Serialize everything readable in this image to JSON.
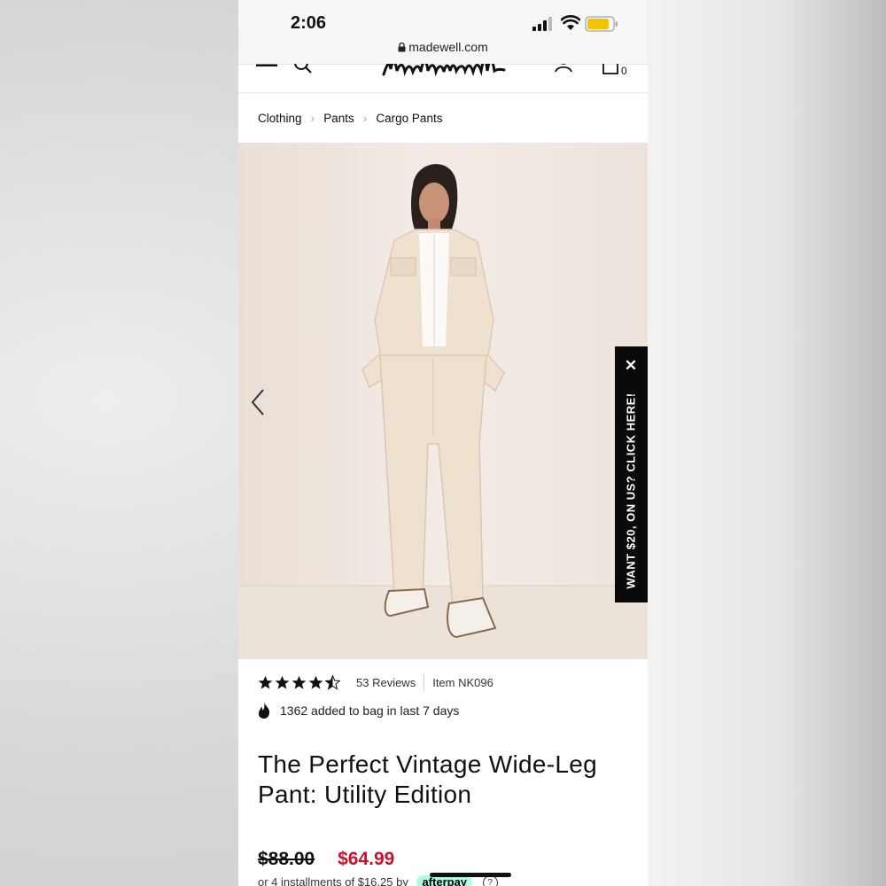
{
  "status_bar": {
    "time": "2:06",
    "url": "madewell.com"
  },
  "header": {
    "logo_text": "Madewell",
    "bag_count": "0"
  },
  "breadcrumb": [
    "Clothing",
    "Pants",
    "Cargo Pants"
  ],
  "promo": {
    "text": "WANT $20, ON US? CLICK HERE!",
    "close": "✕"
  },
  "product": {
    "rating": 4.5,
    "reviews": "53 Reviews",
    "item": "Item NK096",
    "social_proof": "1362 added to bag in last 7 days",
    "title": "The Perfect Vintage Wide-Leg Pant: Utility Edition",
    "old_price": "$88.00",
    "new_price": "$64.99",
    "installments": "or 4 installments of $16.25 by",
    "afterpay": "afterpay",
    "info": "?"
  },
  "colors": {
    "sale_red": "#c8102e",
    "promo_bg": "#0a0a0a",
    "image_bg": "#efe7df",
    "afterpay_mint": "#b2fce4"
  }
}
